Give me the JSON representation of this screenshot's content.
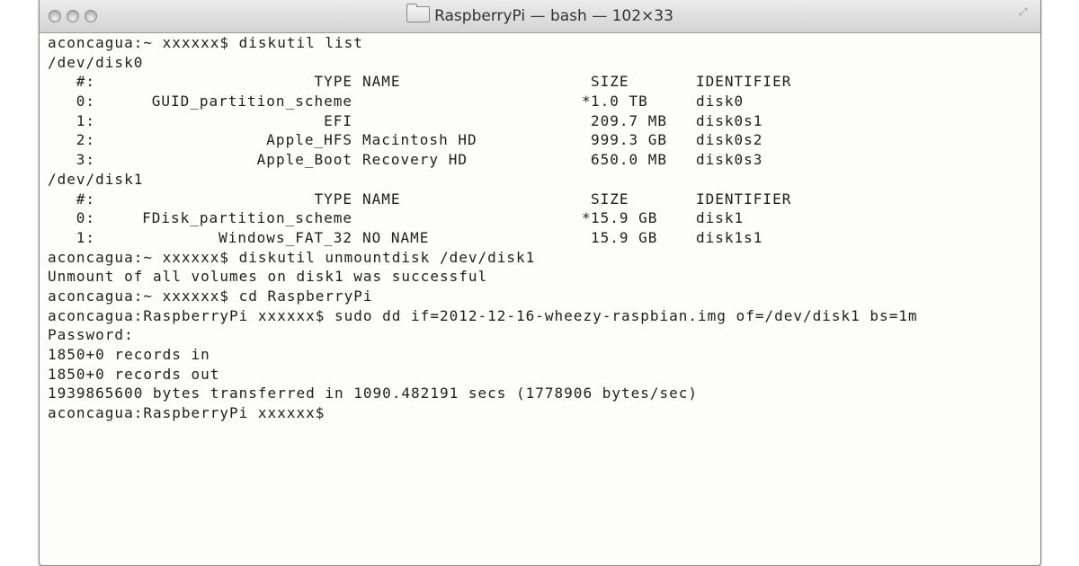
{
  "window": {
    "title": "RaspberryPi — bash — 102×33",
    "folder_icon": "folder-icon"
  },
  "terminal": {
    "cmd1": "aconcagua:~ xxxxxx$ diskutil list",
    "disk0": {
      "device": "/dev/disk0",
      "header": {
        "num": "#:",
        "type": "TYPE",
        "name": "NAME",
        "size": "SIZE",
        "identifier": "IDENTIFIER"
      },
      "rows": [
        {
          "num": "0:",
          "type": "GUID_partition_scheme",
          "name": "",
          "mark": "*",
          "size": "1.0 TB",
          "identifier": "disk0"
        },
        {
          "num": "1:",
          "type": "EFI",
          "name": "",
          "mark": "",
          "size": "209.7 MB",
          "identifier": "disk0s1"
        },
        {
          "num": "2:",
          "type": "Apple_HFS",
          "name": "Macintosh HD",
          "mark": "",
          "size": "999.3 GB",
          "identifier": "disk0s2"
        },
        {
          "num": "3:",
          "type": "Apple_Boot",
          "name": "Recovery HD",
          "mark": "",
          "size": "650.0 MB",
          "identifier": "disk0s3"
        }
      ]
    },
    "disk1": {
      "device": "/dev/disk1",
      "header": {
        "num": "#:",
        "type": "TYPE",
        "name": "NAME",
        "size": "SIZE",
        "identifier": "IDENTIFIER"
      },
      "rows": [
        {
          "num": "0:",
          "type": "FDisk_partition_scheme",
          "name": "",
          "mark": "*",
          "size": "15.9 GB",
          "identifier": "disk1"
        },
        {
          "num": "1:",
          "type": "Windows_FAT_32",
          "name": "NO NAME",
          "mark": "",
          "size": "15.9 GB",
          "identifier": "disk1s1"
        }
      ]
    },
    "after": [
      "aconcagua:~ xxxxxx$ diskutil unmountdisk /dev/disk1",
      "Unmount of all volumes on disk1 was successful",
      "aconcagua:~ xxxxxx$ cd RaspberryPi",
      "aconcagua:RaspberryPi xxxxxx$ sudo dd if=2012-12-16-wheezy-raspbian.img of=/dev/disk1 bs=1m",
      "Password:",
      "1850+0 records in",
      "1850+0 records out",
      "1939865600 bytes transferred in 1090.482191 secs (1778906 bytes/sec)",
      "aconcagua:RaspberryPi xxxxxx$"
    ]
  }
}
